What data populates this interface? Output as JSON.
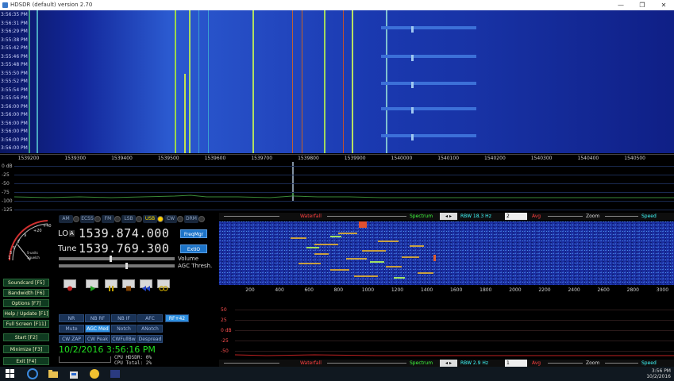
{
  "window": {
    "title": "HDSDR (default) version 2.70",
    "controls": [
      "—",
      "❐",
      "✕"
    ]
  },
  "waterfall": {
    "times": [
      "3:56:35 PM",
      "3:56:31 PM",
      "3:56:29 PM",
      "3:55:38 PM",
      "3:55:42 PM",
      "3:55:46 PM",
      "3:55:48 PM",
      "3:55:50 PM",
      "3:55:52 PM",
      "3:55:54 PM",
      "3:55:56 PM",
      "3:56:00 PM",
      "3:56:00 PM",
      "3:56:00 PM",
      "3:56:00 PM",
      "3:56:00 PM",
      "3:56:00 PM"
    ]
  },
  "freq_scale": {
    "labels": [
      "1539200",
      "1539300",
      "1539400",
      "1539500",
      "1539600",
      "1539700",
      "1539800",
      "1539900",
      "1540000",
      "1540100",
      "1540200",
      "1540300",
      "1540400",
      "1540500"
    ]
  },
  "spectrum": {
    "db_labels": [
      "0 dB",
      "-25",
      "-50",
      "-75",
      "-100",
      "-125"
    ]
  },
  "smeter": {
    "label1": "S-units",
    "label2": "Squelch",
    "scale": [
      "+40",
      "+20",
      "9",
      "7",
      "5",
      "3",
      "1"
    ]
  },
  "modes": [
    "AM",
    "ECSS",
    "FM",
    "LSB",
    "USB",
    "CW",
    "DRM"
  ],
  "active_mode": "USB",
  "lo": {
    "label": "LO",
    "marker": "A",
    "value": "1539.874.000"
  },
  "tune": {
    "label": "Tune",
    "value": "1539.769.300"
  },
  "buttons": {
    "freqmgr": "FreqMgr",
    "extio": "ExtIO",
    "rf": "RF+42"
  },
  "labels": {
    "volume": "Volume",
    "agc": "AGC Thresh."
  },
  "side": [
    "Soundcard [F5]",
    "Bandwidth [F6]",
    "Options [F7]",
    "Help / Update [F1]",
    "Full Screen [F11]",
    "Start [F2]",
    "Minimize [F3]",
    "Exit [F4]"
  ],
  "dsp1": [
    "NR",
    "NB RF",
    "NB IF",
    "AFC"
  ],
  "dsp2": [
    "Mute",
    "AGC Med",
    "Notch",
    "ANotch"
  ],
  "dsp3": [
    "CW ZAP",
    "CW Peak",
    "CWFullBw",
    "Despread"
  ],
  "clock": "10/2/2016 3:56:16 PM",
  "cpu": {
    "hdsdr": "CPU HDSDR: 0%",
    "total": "CPU Total: 2%"
  },
  "ctrl_top": {
    "waterfall": "Waterfall",
    "spectrum": "Spectrum",
    "rbw": "RBW 18.3 Hz",
    "avg_val": "2",
    "avg": "Avg",
    "zoom": "Zoom",
    "speed": "Speed"
  },
  "ctrl_bottom": {
    "waterfall": "Waterfall",
    "spectrum": "Spectrum",
    "rbw": "RBW 2.9 Hz",
    "avg_val": "1",
    "avg": "Avg",
    "zoom": "Zoom",
    "speed": "Speed"
  },
  "audio_scale": [
    "200",
    "400",
    "600",
    "800",
    "1000",
    "1200",
    "1400",
    "1600",
    "1800",
    "2000",
    "2200",
    "2400",
    "2600",
    "2800",
    "3000"
  ],
  "audio_db": [
    "50",
    "25",
    "0 dB",
    "-25",
    "-50"
  ],
  "tray": {
    "time": "3:56 PM",
    "date": "10/2/2016"
  },
  "colors": {
    "accent": "#1d74c8",
    "waterfall": "#1a2fa0",
    "clock": "#21e021"
  }
}
